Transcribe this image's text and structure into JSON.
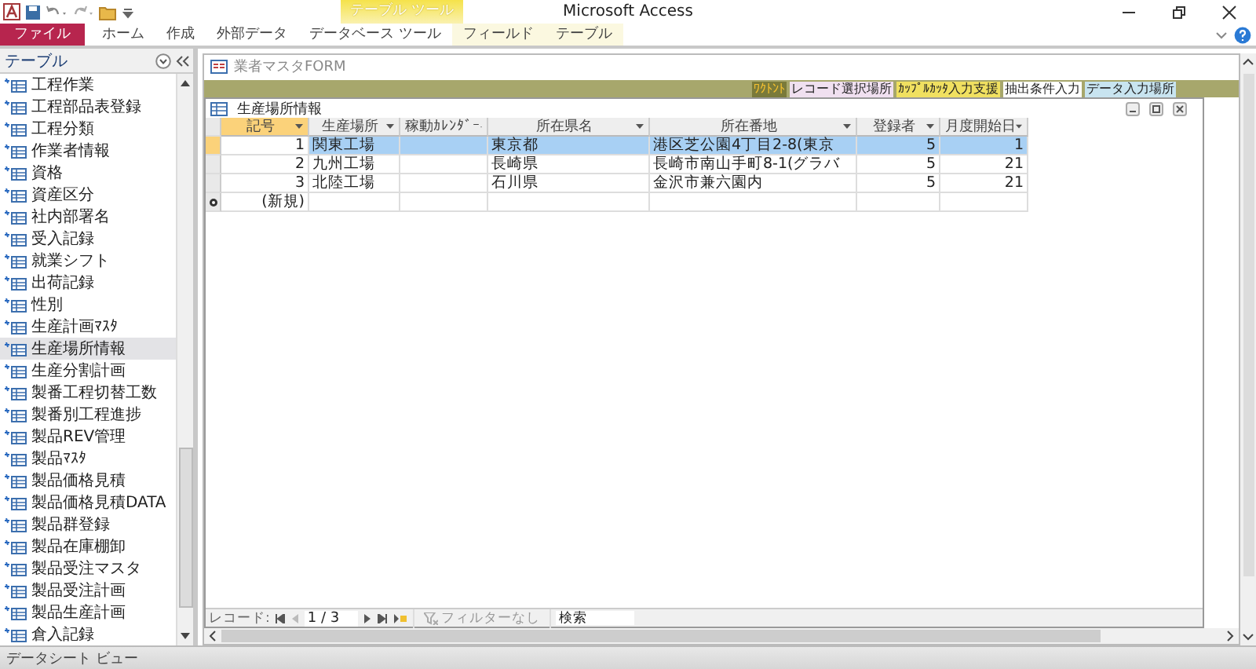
{
  "window": {
    "title": "Microsoft Access"
  },
  "ribbon": {
    "contextual_group": "テーブル ツール",
    "tabs": [
      {
        "label": "ファイル",
        "kind": "file"
      },
      {
        "label": "ホーム",
        "kind": "tab"
      },
      {
        "label": "作成",
        "kind": "tab"
      },
      {
        "label": "外部データ",
        "kind": "tab"
      },
      {
        "label": "データベース ツール",
        "kind": "tab"
      },
      {
        "label": "フィールド",
        "kind": "contextual"
      },
      {
        "label": "テーブル",
        "kind": "contextual"
      }
    ]
  },
  "nav_pane": {
    "title": "テーブル",
    "items": [
      {
        "label": "工程作業",
        "selected": false
      },
      {
        "label": "工程部品表登録",
        "selected": false
      },
      {
        "label": "工程分類",
        "selected": false
      },
      {
        "label": "作業者情報",
        "selected": false
      },
      {
        "label": "資格",
        "selected": false
      },
      {
        "label": "資産区分",
        "selected": false
      },
      {
        "label": "社内部署名",
        "selected": false
      },
      {
        "label": "受入記録",
        "selected": false
      },
      {
        "label": "就業シフト",
        "selected": false
      },
      {
        "label": "出荷記録",
        "selected": false
      },
      {
        "label": "性別",
        "selected": false
      },
      {
        "label": "生産計画ﾏｽﾀ",
        "selected": false
      },
      {
        "label": "生産場所情報",
        "selected": true
      },
      {
        "label": "生産分割計画",
        "selected": false
      },
      {
        "label": "製番工程切替工数",
        "selected": false
      },
      {
        "label": "製番別工程進捗",
        "selected": false
      },
      {
        "label": "製品REV管理",
        "selected": false
      },
      {
        "label": "製品ﾏｽﾀ",
        "selected": false
      },
      {
        "label": "製品価格見積",
        "selected": false
      },
      {
        "label": "製品価格見積DATA",
        "selected": false
      },
      {
        "label": "製品群登録",
        "selected": false
      },
      {
        "label": "製品在庫棚卸",
        "selected": false
      },
      {
        "label": "製品受注マスタ",
        "selected": false
      },
      {
        "label": "製品受注計画",
        "selected": false
      },
      {
        "label": "製品生産計画",
        "selected": false
      },
      {
        "label": "倉入記録",
        "selected": false
      }
    ]
  },
  "form_window": {
    "title": "業者マスタFORM",
    "banner": {
      "buttons": [
        {
          "label": "ﾜｸﾄﾝﾄ",
          "color": "#7a7a3a"
        },
        {
          "label": "レコード選択場所",
          "color": "#f0e0f0"
        },
        {
          "label": "ｶｯﾌﾟﾙｶｯﾀ入力支援",
          "color": "#f0e060"
        },
        {
          "label": "抽出条件入力",
          "color": "#ffffff"
        },
        {
          "label": "データ入力場所",
          "color": "#c8e4f0"
        }
      ]
    }
  },
  "datasheet": {
    "title": "生産場所情報",
    "columns": [
      "記号",
      "生産場所",
      "稼動ｶﾚﾝﾀﾞｰ",
      "所在県名",
      "所在番地",
      "登録者",
      "月度開始日"
    ],
    "rows": [
      {
        "selected": true,
        "cells": [
          "1",
          "関東工場",
          "",
          "東京都",
          "港区芝公園4丁目2-8(東京",
          "5",
          "1"
        ]
      },
      {
        "selected": false,
        "cells": [
          "2",
          "九州工場",
          "",
          "長崎県",
          "長崎市南山手町8-1(グラバ",
          "5",
          "21"
        ]
      },
      {
        "selected": false,
        "cells": [
          "3",
          "北陸工場",
          "",
          "石川県",
          "金沢市兼六園内",
          "5",
          "21"
        ]
      }
    ],
    "new_row_label": "(新規)",
    "navigation": {
      "label": "レコード:",
      "position": "1 / 3",
      "filter": "フィルターなし",
      "search_placeholder": "検索"
    }
  },
  "status_bar": {
    "text": "データシート ビュー"
  }
}
